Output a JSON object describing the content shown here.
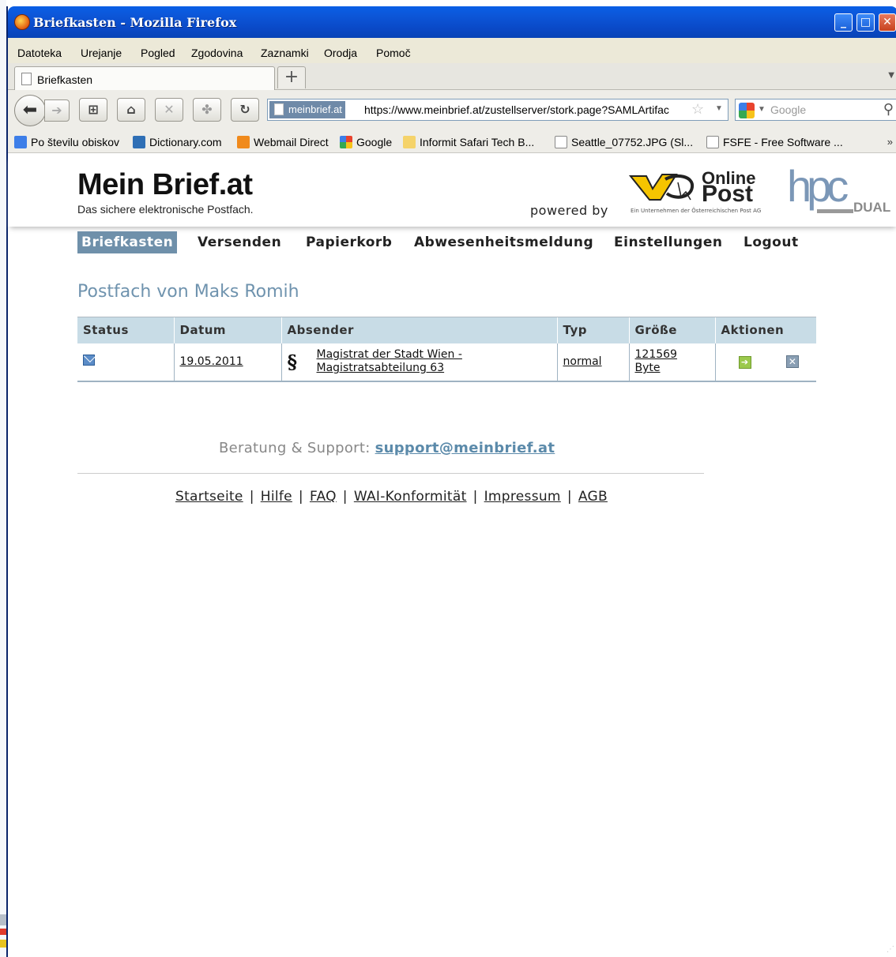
{
  "window": {
    "title": "Briefkasten - Mozilla Firefox"
  },
  "menu": [
    "Datoteka",
    "Urejanje",
    "Pogled",
    "Zgodovina",
    "Zaznamki",
    "Orodja",
    "Pomoč"
  ],
  "tab": {
    "label": "Briefkasten",
    "new_tab": "+"
  },
  "address": {
    "site_label": "meinbrief.at",
    "url": "https://www.meinbrief.at/zustellserver/stork.page?SAMLArtifac"
  },
  "search": {
    "placeholder": "Google"
  },
  "bookmarks": [
    {
      "label": "Po številu obiskov",
      "icon": "most-visited-icon",
      "color": "#3d7ee8"
    },
    {
      "label": "Dictionary.com",
      "icon": "dictionary-icon",
      "color": "#2f6fb5"
    },
    {
      "label": "Webmail Direct",
      "icon": "mail-icon",
      "color": "#f08a1c"
    },
    {
      "label": "Google",
      "icon": "google-icon",
      "color": "#36a852"
    },
    {
      "label": "Informit Safari Tech B...",
      "icon": "rss-icon",
      "color": "#f5b400"
    },
    {
      "label": "Seattle_07752.JPG (Sl...",
      "icon": "page-icon",
      "color": "#ffffff"
    },
    {
      "label": "FSFE - Free Software ...",
      "icon": "page-icon",
      "color": "#ffffff"
    }
  ],
  "bookmarks_more": "»",
  "site": {
    "logo": "Mein Brief.at",
    "tagline": "Das sichere elektronische Postfach.",
    "powered_by": "powered by",
    "partner_online": "Online",
    "partner_post": "Post",
    "partner_sub": "Ein Unternehmen der Österreichischen Post AG",
    "partner2": "hpc",
    "partner2_sub": "DUAL"
  },
  "nav": [
    "Briefkasten",
    "Versenden",
    "Papierkorb",
    "Abwesenheitsmeldung",
    "Einstellungen",
    "Logout"
  ],
  "mailbox_title": "Postfach von Maks Romih",
  "table": {
    "headers": [
      "Status",
      "Datum",
      "Absender",
      "Typ",
      "Größe",
      "Aktionen"
    ],
    "rows": [
      {
        "date": "19.05.2011",
        "sender_line1": "Magistrat der Stadt Wien -",
        "sender_line2": "Magistratsabteilung 63",
        "type": "normal",
        "size_line1": "121569",
        "size_line2": "Byte"
      }
    ]
  },
  "support": {
    "label": "Beratung & Support:",
    "email": "support@meinbrief.at"
  },
  "footer": [
    "Startseite",
    "Hilfe",
    "FAQ",
    "WAI-Konformität",
    "Impressum",
    "AGB"
  ]
}
